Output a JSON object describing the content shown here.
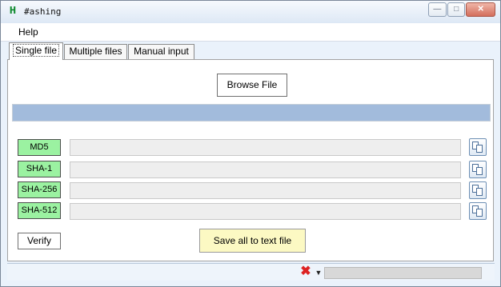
{
  "app": {
    "logo_text": "H",
    "title": "#ashing"
  },
  "window_controls": {
    "minimize": "—",
    "maximize": "□",
    "close": "✕"
  },
  "menu": {
    "help": "Help"
  },
  "tabs": [
    {
      "label": "Single file",
      "active": true
    },
    {
      "label": "Multiple files",
      "active": false
    },
    {
      "label": "Manual input",
      "active": false
    }
  ],
  "single_file": {
    "browse_label": "Browse File",
    "progress_fraction": 1.0,
    "hashes": [
      {
        "label": "MD5",
        "value": ""
      },
      {
        "label": "SHA-1",
        "value": ""
      },
      {
        "label": "SHA-256",
        "value": ""
      },
      {
        "label": "SHA-512",
        "value": ""
      }
    ],
    "verify_label": "Verify",
    "save_label": "Save all to text file"
  },
  "statusbar": {
    "text": "",
    "stop_icon": "✖",
    "dropdown_icon": "▼",
    "progress_fraction": 0
  },
  "colors": {
    "progress": "#a2bbdc",
    "hash_label": "#9bf2a1",
    "save_button": "#fcf9c3",
    "stop_icon": "#dd2222"
  }
}
